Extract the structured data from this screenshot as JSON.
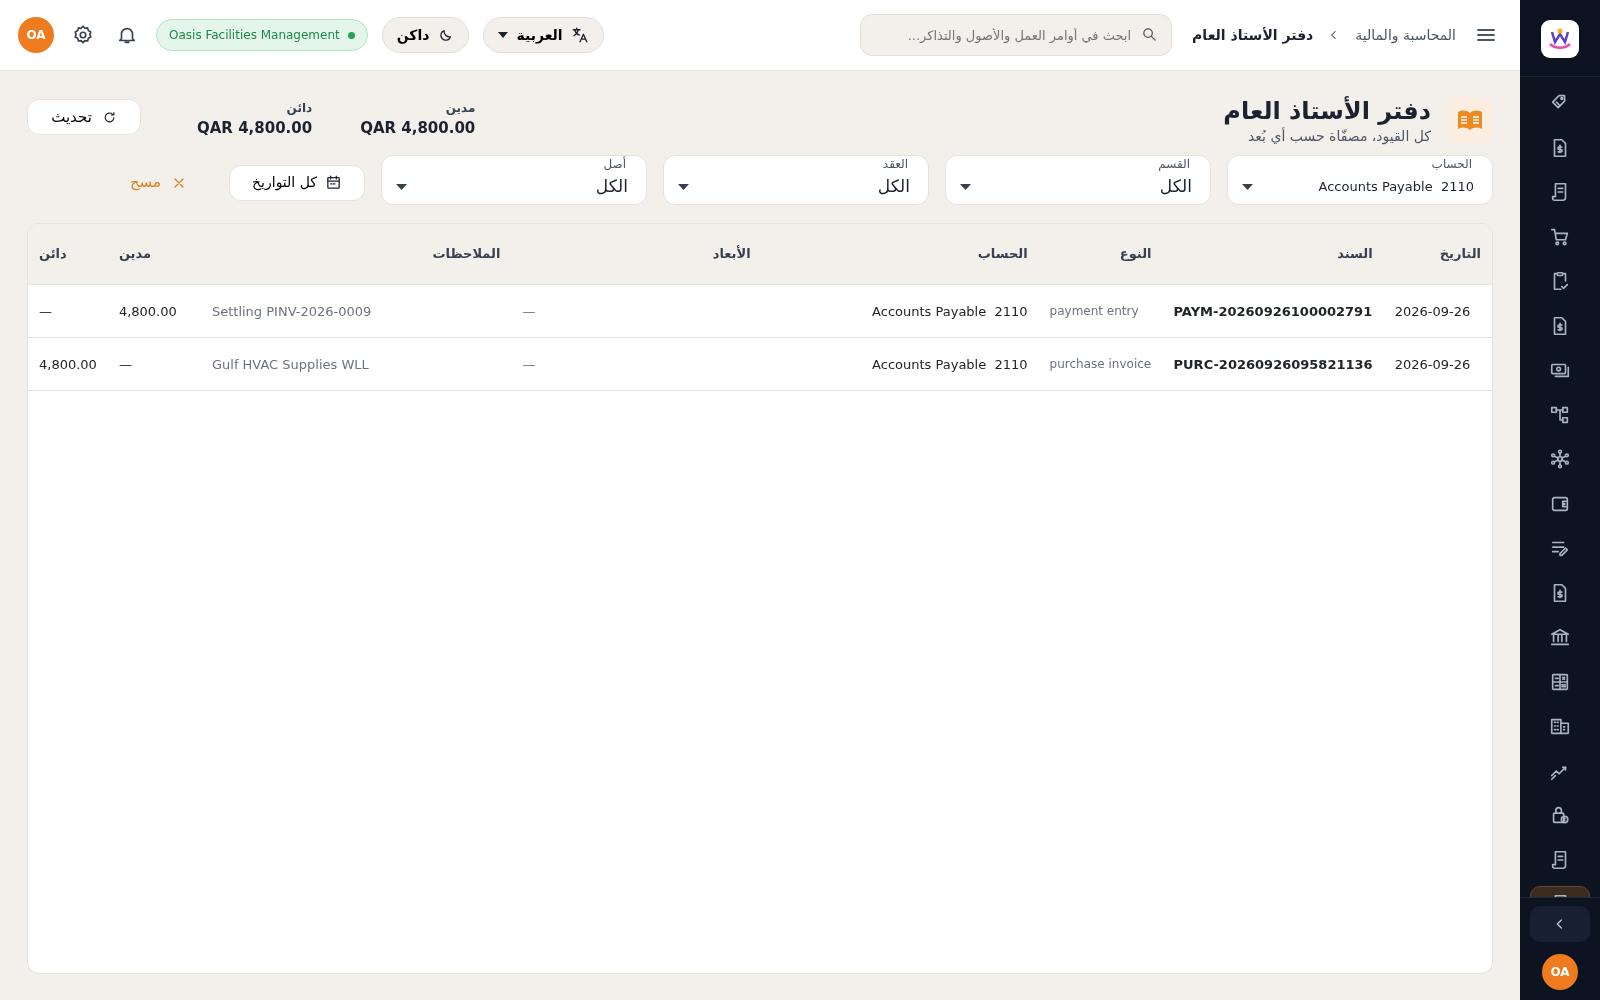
{
  "sidebar": {
    "items": [
      {
        "selected": false
      },
      {
        "selected": false
      },
      {
        "selected": false
      },
      {
        "selected": false
      },
      {
        "selected": false
      },
      {
        "selected": false
      },
      {
        "selected": false
      },
      {
        "selected": false
      },
      {
        "selected": false
      },
      {
        "selected": false
      },
      {
        "selected": false
      },
      {
        "selected": false
      },
      {
        "selected": false
      },
      {
        "selected": false
      },
      {
        "selected": false
      },
      {
        "selected": false
      },
      {
        "selected": false
      },
      {
        "selected": false
      },
      {
        "selected": true
      }
    ],
    "avatar": "OA"
  },
  "header": {
    "breadcrumb": [
      "المحاسبة والمالية",
      "دفتر الأستاذ العام"
    ],
    "search": {
      "placeholder": "ابحث في أوامر العمل والأصول والتذاكر..."
    },
    "language": "العربية",
    "theme": "داكن",
    "company": {
      "name": "Oasis Facilities Management",
      "color": "#22a553"
    },
    "avatar": "OA"
  },
  "page": {
    "title": "دفتر الأستاذ العام",
    "subtitle": "كل القيود، مصفّاة حسب أي بُعد",
    "totals": [
      {
        "label": "مدين",
        "value": "QAR 4,800.00"
      },
      {
        "label": "دائن",
        "value": "QAR 4,800.00"
      }
    ],
    "refresh": "تحديث"
  },
  "filters": [
    {
      "label": "الحساب",
      "value": "2110  Accounts Payable"
    },
    {
      "label": "القسم",
      "value": "الكل"
    },
    {
      "label": "العقد",
      "value": "الكل"
    },
    {
      "label": "أصل",
      "value": "الكل"
    }
  ],
  "date_filter": "كل التواريخ",
  "clear": "مسح",
  "table": {
    "columns": [
      "التاريخ",
      "السند",
      "النوع",
      "الحساب",
      "الأبعاد",
      "الملاحظات",
      "مدين",
      "دائن"
    ],
    "rows": [
      [
        "2026-09-26",
        "PAYM-20260926100002791",
        "payment entry",
        "2110  Accounts Payable",
        "—",
        "Settling PINV-2026-0009",
        "4,800.00",
        "—"
      ],
      [
        "2026-09-26",
        "PURC-20260926095821136",
        "purchase invoice",
        "2110  Accounts Payable",
        "—",
        "Gulf HVAC Supplies WLL",
        "—",
        "4,800.00"
      ]
    ]
  }
}
